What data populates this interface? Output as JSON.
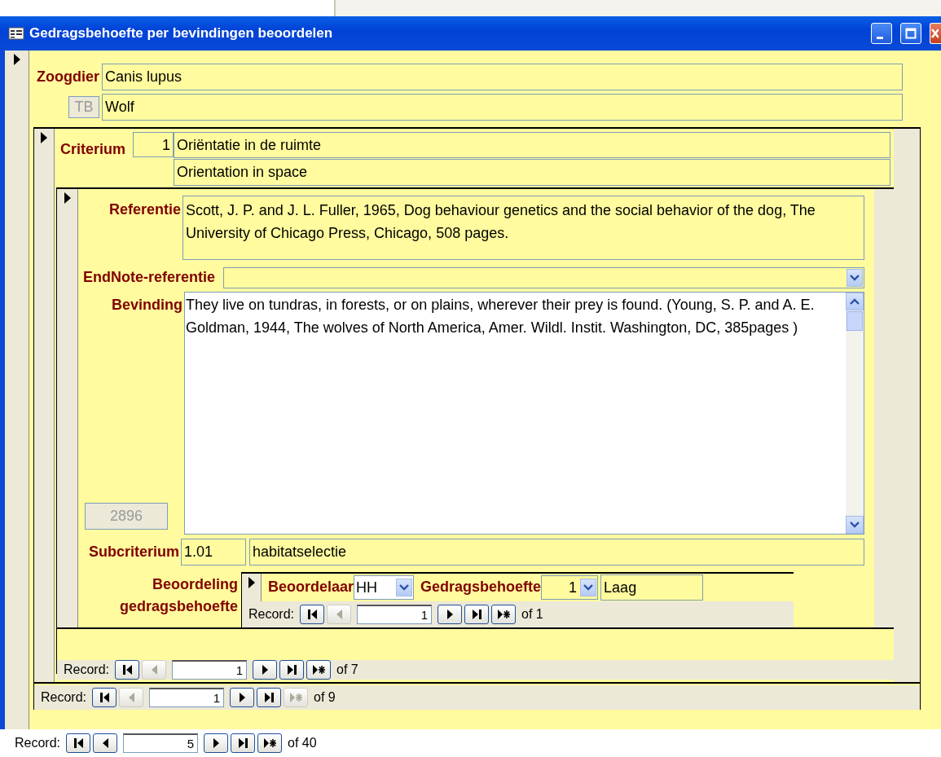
{
  "window": {
    "title": "Gedragsbehoefte per bevindingen beoordelen"
  },
  "mammal": {
    "label": "Zoogdier",
    "name": "Canis lupus",
    "code": "TB",
    "common_name": "Wolf"
  },
  "criterion": {
    "label": "Criterium",
    "number": "1",
    "name_nl": "Oriëntatie in de ruimte",
    "name_en": "Orientation in space",
    "finding": {
      "reference_label": "Referentie",
      "reference": "Scott, J. P. and J. L. Fuller, 1965, Dog behaviour genetics and the social behavior of the dog, The University of Chicago Press, Chicago, 508 pages.",
      "endnote_label": "EndNote-referentie",
      "finding_label": "Bevinding",
      "finding": "They live on tundras, in forests, or on plains, wherever their prey is found. (Young, S. P. and A. E. Goldman, 1944, The wolves of North America, Amer. Wildl. Instit. Washington, DC, 385pages )",
      "id": "2896",
      "subcriterion_label": "Subcriterium",
      "subcriterion_code": "1.01",
      "subcriterion_name": "habitatselectie",
      "assessment": {
        "label": "Beoordeling gedragsbehoefte",
        "assessor_label": "Beoordelaar",
        "assessor": "HH",
        "need_label": "Gedragsbehoefte",
        "need_level": "1",
        "need_name": "Laag",
        "nav": {
          "label": "Record:",
          "current": "1",
          "total": "of 1",
          "buttons": [
            {
              "kind": "first",
              "disabled": false
            },
            {
              "kind": "prev",
              "disabled": true
            },
            {
              "kind": "next",
              "disabled": false
            },
            {
              "kind": "last",
              "disabled": false
            },
            {
              "kind": "new",
              "disabled": false
            }
          ]
        }
      }
    },
    "nav": {
      "label": "Record:",
      "current": "1",
      "total": "of 7",
      "buttons": [
        {
          "kind": "first",
          "disabled": false
        },
        {
          "kind": "prev",
          "disabled": true
        },
        {
          "kind": "next",
          "disabled": false
        },
        {
          "kind": "last",
          "disabled": false
        },
        {
          "kind": "new",
          "disabled": false
        }
      ]
    }
  },
  "criterion_nav": {
    "label": "Record:",
    "current": "1",
    "total": "of 9",
    "buttons": [
      {
        "kind": "first",
        "disabled": false
      },
      {
        "kind": "prev",
        "disabled": true
      },
      {
        "kind": "next",
        "disabled": false
      },
      {
        "kind": "last",
        "disabled": false
      },
      {
        "kind": "new",
        "disabled": true
      }
    ]
  },
  "nav": {
    "label": "Record:",
    "current": "5",
    "total": "of 40",
    "buttons": [
      {
        "kind": "first",
        "disabled": false
      },
      {
        "kind": "prev",
        "disabled": false
      },
      {
        "kind": "next",
        "disabled": false
      },
      {
        "kind": "last",
        "disabled": false
      },
      {
        "kind": "new",
        "disabled": false
      }
    ]
  }
}
